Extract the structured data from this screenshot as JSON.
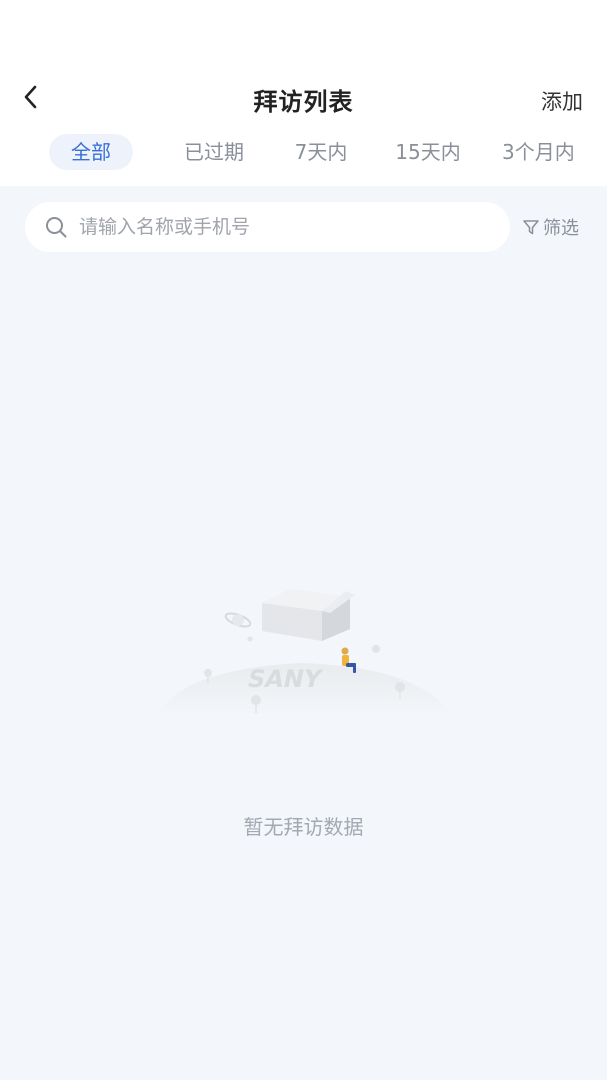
{
  "header": {
    "title": "拜访列表",
    "add_label": "添加"
  },
  "tabs": [
    {
      "label": "全部",
      "active": true
    },
    {
      "label": "已过期",
      "active": false
    },
    {
      "label": "7天内",
      "active": false
    },
    {
      "label": "15天内",
      "active": false
    },
    {
      "label": "3个月内",
      "active": false
    }
  ],
  "search": {
    "placeholder": "请输入名称或手机号",
    "value": ""
  },
  "filter": {
    "label": "筛选"
  },
  "empty": {
    "message": "暂无拜访数据",
    "logo_text": "SANY"
  },
  "colors": {
    "accent": "#3a6fd8",
    "background": "#f3f6fa",
    "muted_text": "#a3a9b3"
  }
}
